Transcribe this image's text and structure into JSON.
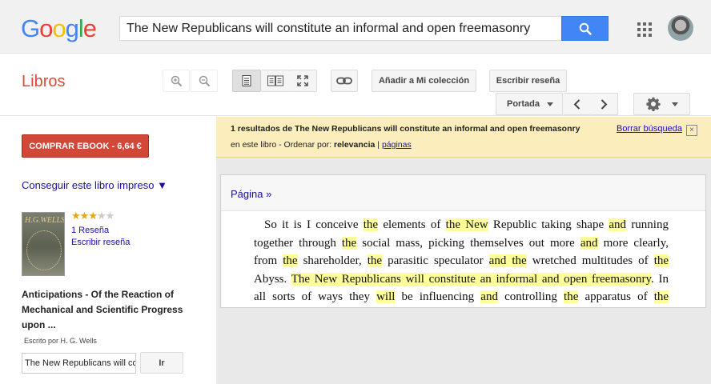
{
  "header": {
    "logo_letters": [
      "G",
      "o",
      "o",
      "g",
      "l",
      "e"
    ],
    "search_query": "The New Republicans will constitute an informal and open freemasonry"
  },
  "bookbar": {
    "section_title": "Libros",
    "add_collection": "Añadir a Mi colección",
    "write_review": "Escribir reseña",
    "portada": "Portada"
  },
  "sidebar": {
    "buy_button": "COMPRAR EBOOK - 6,64 €",
    "print_link": "Conseguir este libro impreso ▼",
    "cover_text": "H.G.WELLS",
    "rating": 3,
    "rating_max": 5,
    "reviews_link": "1 Reseña",
    "write_review_link": "Escribir reseña",
    "book_title": "Anticipations - Of the Reaction of Mechanical and Scientific Progress upon ...",
    "author_line": "Escrito por H. G. Wells",
    "search_value": "The New Republicans will co",
    "go_button": "Ir"
  },
  "results_bar": {
    "count_prefix": "1 resultados de ",
    "query": "The New Republicans will constitute an informal and open freemasonry",
    "scope": "en este libro",
    "separator": " - ",
    "order_label": "Ordenar por: ",
    "order_value": "relevancia",
    "pipe": " | ",
    "pages_link": "páginas",
    "clear_link": "Borrar búsqueda",
    "close": "×"
  },
  "page": {
    "page_link": "Página »",
    "lines": [
      [
        [
          "So it is I conceive ",
          false
        ],
        [
          "the",
          true
        ],
        [
          " elements of ",
          false
        ],
        [
          "the New",
          true
        ],
        [
          " Republic taking shape ",
          false
        ],
        [
          "and",
          true
        ],
        [
          " running",
          false
        ]
      ],
      [
        [
          "together through ",
          false
        ],
        [
          "the",
          true
        ],
        [
          " social mass, picking themselves out more ",
          false
        ],
        [
          "and",
          true
        ],
        [
          " more clearly,",
          false
        ]
      ],
      [
        [
          "from ",
          false
        ],
        [
          "the",
          true
        ],
        [
          " shareholder, ",
          false
        ],
        [
          "the",
          true
        ],
        [
          " parasitic speculator ",
          false
        ],
        [
          "and the",
          true
        ],
        [
          " wretched multitudes of ",
          false
        ],
        [
          "the",
          true
        ]
      ],
      [
        [
          "Abyss. ",
          false
        ],
        [
          "The New Republicans will constitute an informal and open freemasonry",
          true
        ],
        [
          ". In",
          false
        ]
      ],
      [
        [
          "all sorts of ways they ",
          false
        ],
        [
          "will",
          true
        ],
        [
          " be influencing ",
          false
        ],
        [
          "and",
          true
        ],
        [
          " controlling ",
          false
        ],
        [
          "the",
          true
        ],
        [
          " apparatus of ",
          false
        ],
        [
          "the",
          true
        ]
      ]
    ]
  },
  "colors": {
    "brand_red": "#dd4b39",
    "search_blue": "#4285f4",
    "highlight": "#ffff99",
    "infobar": "#fbeebc",
    "logo": [
      "#4285f4",
      "#ea4335",
      "#fbbc05",
      "#4285f4",
      "#34a853",
      "#ea4335"
    ]
  }
}
